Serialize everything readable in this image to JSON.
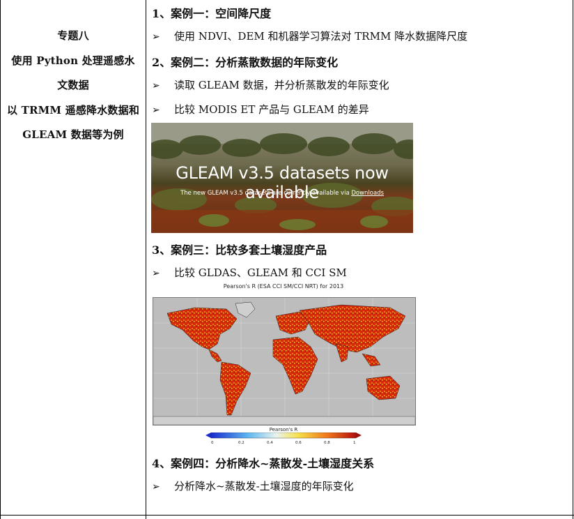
{
  "left": {
    "lines": [
      "专题八",
      "使用 Python 处理遥感水",
      "文数据",
      "以 TRMM 遥感降水数据和",
      "GLEAM 数据等为例"
    ]
  },
  "right": {
    "case1_heading": "1、案例一：空间降尺度",
    "case1_bullet": "使用 NDVI、DEM 和机器学习算法对 TRMM 降水数据降尺度",
    "case2_heading": "2、案例二：分析蒸散数据的年际变化",
    "case2_bullets": [
      "读取 GLEAM 数据，并分析蒸散发的年际变化",
      "比较 MODIS ET 产品与 GLEAM 的差异"
    ],
    "banner": {
      "title": "GLEAM v3.5 datasets now available",
      "subtitle_prefix": "The new GLEAM v3.5 datasets are currently available via ",
      "subtitle_link": "Downloads"
    },
    "case3_heading": "3、案例三：比较多套土壤湿度产品",
    "case3_bullet": "比较 GLDAS、GLEAM 和 CCI SM",
    "map": {
      "title": "Pearson's R (ESA CCI SM/CCI NRT) for 2013",
      "colorbar_label": "Pearson's R",
      "colorbar_ticks": [
        "0",
        "0.2",
        "0.4",
        "0.6",
        "0.8",
        "1"
      ]
    },
    "case4_heading": "4、案例四：分析降水~蒸散发-土壤湿度关系",
    "case4_bullet": "分析降水~蒸散发-土壤湿度的年际变化"
  },
  "colors": {
    "ocean": "#bdbdbd",
    "land_red": "#d42a0a",
    "land_orange": "#f07a18"
  },
  "icons": {
    "bullet": "arrow-bullet-icon"
  }
}
